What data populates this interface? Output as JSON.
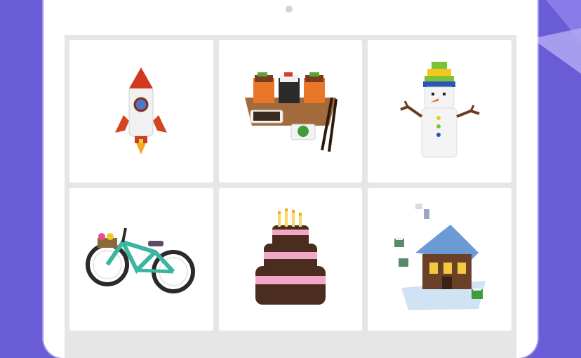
{
  "gallery": {
    "items": [
      {
        "id": "rocket",
        "icon": "voxel-rocket-icon"
      },
      {
        "id": "sushi",
        "icon": "voxel-sushi-icon"
      },
      {
        "id": "snowman",
        "icon": "voxel-snowman-icon"
      },
      {
        "id": "bicycle",
        "icon": "voxel-bicycle-icon"
      },
      {
        "id": "cake",
        "icon": "voxel-cake-icon"
      },
      {
        "id": "house",
        "icon": "voxel-snow-house-icon"
      }
    ]
  },
  "colors": {
    "background": "#6a5bd6",
    "device": "#ffffff",
    "grid": "#e6e6e6",
    "tile": "#ffffff"
  }
}
